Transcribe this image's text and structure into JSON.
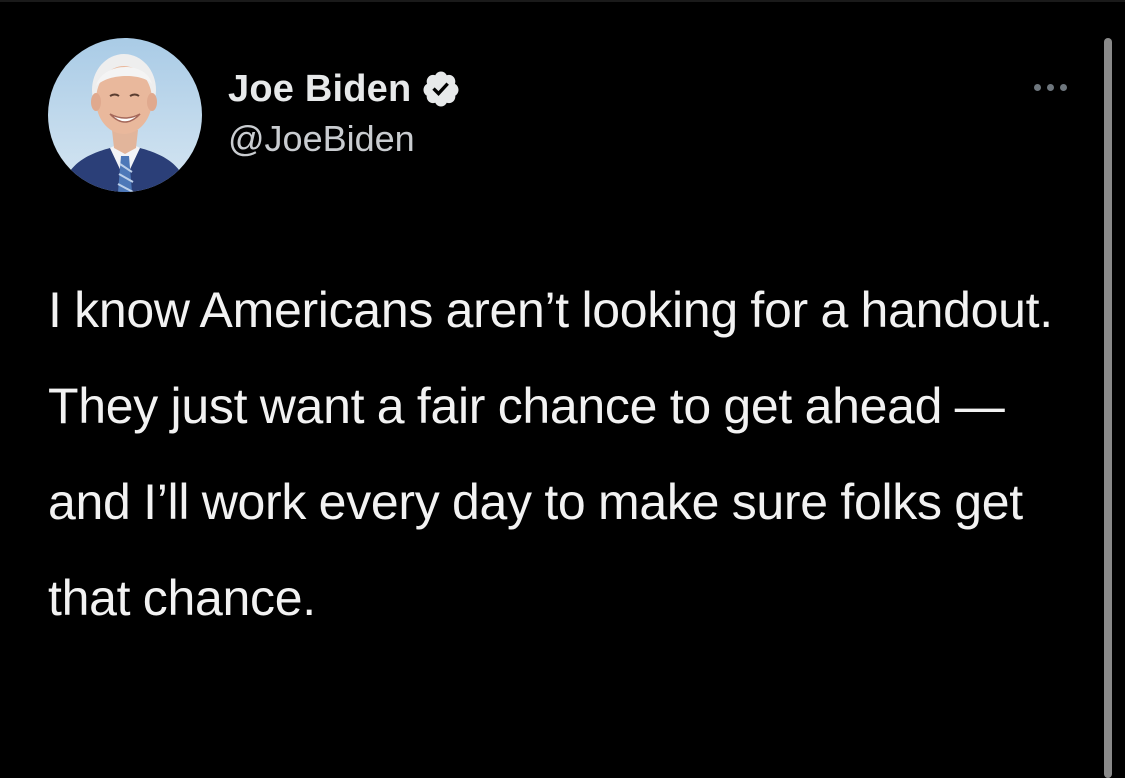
{
  "tweet": {
    "author": {
      "display_name": "Joe Biden",
      "handle": "@JoeBiden",
      "verified": true,
      "avatar_icon": "portrait-avatar"
    },
    "more_icon": "more-horizontal-icon",
    "text": "I know Americans aren’t looking for a handout. They just want a fair chance to get ahead — and I’ll work every day to make sure folks get that chance."
  },
  "colors": {
    "background": "#000000",
    "text_primary": "#e7e9ea",
    "text_secondary": "#c9ccd0",
    "verified_badge": "#e7e9ea",
    "icon_muted": "#6e767d"
  }
}
